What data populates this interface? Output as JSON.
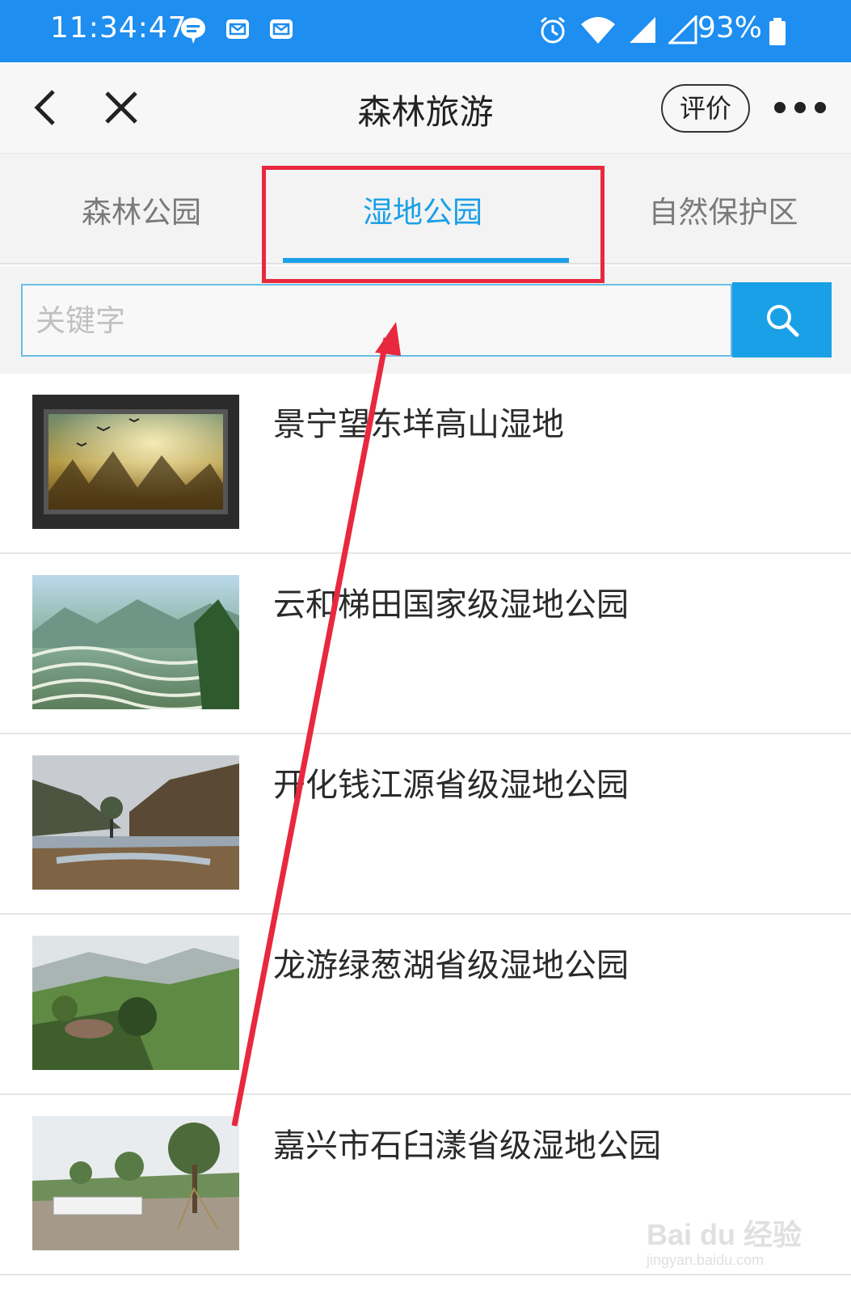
{
  "status_bar": {
    "time": "11:34:47",
    "battery": "93%",
    "icons_left": [
      "chat-bubble-icon",
      "mail-icon",
      "mail-icon"
    ],
    "icons_right": [
      "alarm-icon",
      "wifi-icon",
      "signal-icon",
      "signal-empty-icon",
      "battery-icon"
    ]
  },
  "nav": {
    "title": "森林旅游",
    "rate_label": "评价",
    "back_icon": "chevron-left-icon",
    "close_icon": "close-icon",
    "more_icon": "more-dots-icon"
  },
  "tabs": [
    {
      "label": "森林公园",
      "active": false
    },
    {
      "label": "湿地公园",
      "active": true
    },
    {
      "label": "自然保护区",
      "active": false
    }
  ],
  "search": {
    "placeholder": "关键字",
    "icon": "search-icon"
  },
  "items": [
    {
      "title": "景宁望东垟高山湿地"
    },
    {
      "title": "云和梯田国家级湿地公园"
    },
    {
      "title": "开化钱江源省级湿地公园"
    },
    {
      "title": "龙游绿葱湖省级湿地公园"
    },
    {
      "title": "嘉兴市石臼漾省级湿地公园"
    }
  ],
  "watermark": {
    "brand": "Bai du 经验",
    "url": "jingyan.baidu.com"
  },
  "colors": {
    "status_bar": "#1e8ef0",
    "accent": "#1aa0e6",
    "annotation": "#e8283f"
  }
}
